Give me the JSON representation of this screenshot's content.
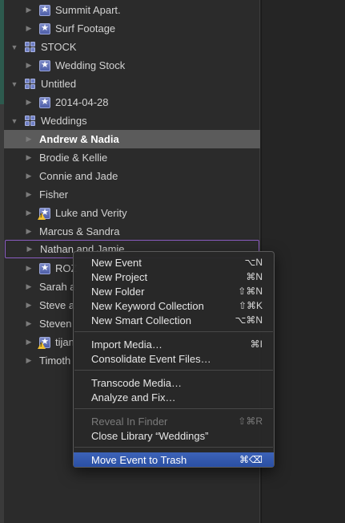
{
  "sidebar": {
    "rows": [
      {
        "label": "Summit Apart.",
        "icon": "star",
        "indent": 1
      },
      {
        "label": "Surf Footage",
        "icon": "star",
        "indent": 1
      },
      {
        "label": "STOCK",
        "icon": "grid",
        "indent": 0
      },
      {
        "label": "Wedding Stock",
        "icon": "star",
        "indent": 1
      },
      {
        "label": "Untitled",
        "icon": "grid",
        "indent": 0
      },
      {
        "label": "2014-04-28",
        "icon": "star",
        "indent": 1
      },
      {
        "label": "Weddings",
        "icon": "grid",
        "indent": 0
      },
      {
        "label": "Andrew & Nadia",
        "icon": "none",
        "indent": 1
      },
      {
        "label": "Brodie & Kellie",
        "icon": "none",
        "indent": 1
      },
      {
        "label": "Connie and Jade",
        "icon": "none",
        "indent": 1
      },
      {
        "label": "Fisher",
        "icon": "none",
        "indent": 1
      },
      {
        "label": "Luke and Verity",
        "icon": "star-warning",
        "indent": 1
      },
      {
        "label": "Marcus & Sandra",
        "icon": "none",
        "indent": 1
      },
      {
        "label": "Nathan and Jamie",
        "icon": "none",
        "indent": 1
      },
      {
        "label": "ROZ",
        "icon": "star",
        "indent": 1
      },
      {
        "label": "Sarah a",
        "icon": "none",
        "indent": 1
      },
      {
        "label": "Steve a",
        "icon": "none",
        "indent": 1
      },
      {
        "label": "Steven",
        "icon": "none",
        "indent": 1
      },
      {
        "label": "tijan",
        "icon": "star-warning",
        "indent": 1
      },
      {
        "label": "Timoth",
        "icon": "none",
        "indent": 1
      }
    ]
  },
  "context_menu": {
    "groups": [
      [
        {
          "label": "New Event",
          "shortcut": "⌥N"
        },
        {
          "label": "New Project",
          "shortcut": "⌘N"
        },
        {
          "label": "New Folder",
          "shortcut": "⇧⌘N"
        },
        {
          "label": "New Keyword Collection",
          "shortcut": "⇧⌘K"
        },
        {
          "label": "New Smart Collection",
          "shortcut": "⌥⌘N"
        }
      ],
      [
        {
          "label": "Import Media…",
          "shortcut": "⌘I"
        },
        {
          "label": "Consolidate Event Files…",
          "shortcut": ""
        }
      ],
      [
        {
          "label": "Transcode Media…",
          "shortcut": ""
        },
        {
          "label": "Analyze and Fix…",
          "shortcut": ""
        }
      ],
      [
        {
          "label": "Reveal In Finder",
          "shortcut": "⇧⌘R"
        },
        {
          "label": "Close Library “Weddings”",
          "shortcut": ""
        }
      ],
      [
        {
          "label": "Move Event to Trash",
          "shortcut": "⌘⌫"
        }
      ]
    ]
  }
}
